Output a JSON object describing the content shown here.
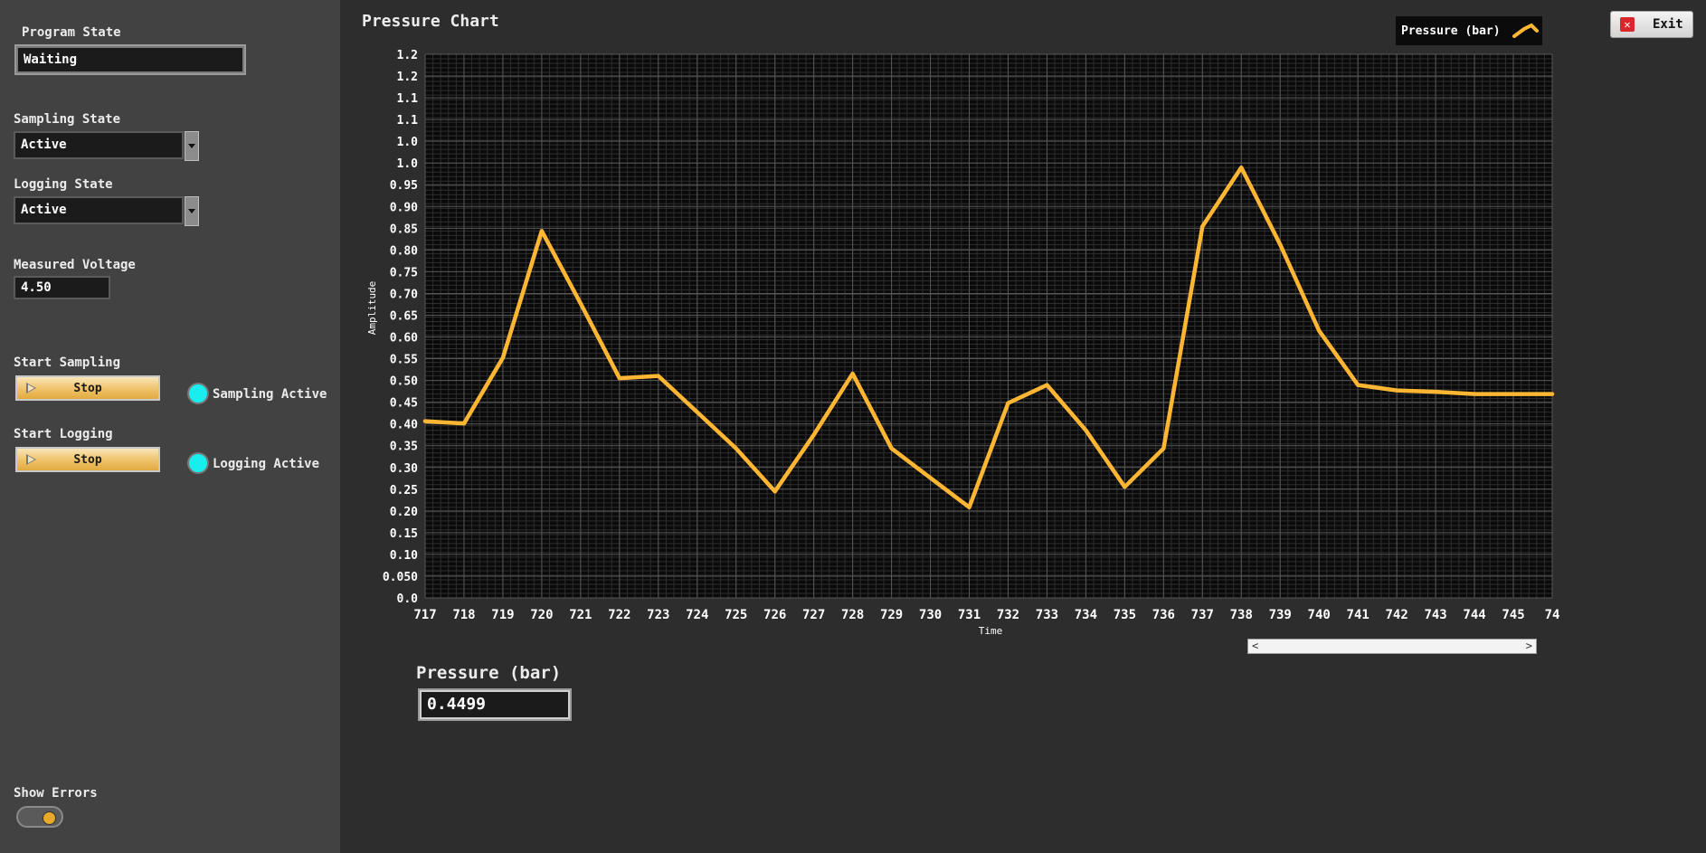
{
  "window": {
    "exit_label": "Exit"
  },
  "left": {
    "program_state": {
      "label": "Program State",
      "value": "Waiting"
    },
    "sampling_state": {
      "label": "Sampling State",
      "value": "Active"
    },
    "logging_state": {
      "label": "Logging State",
      "value": "Active"
    },
    "measured_voltage": {
      "label": "Measured Voltage",
      "value": "4.50"
    },
    "start_sampling": {
      "label": "Start Sampling",
      "button": "Stop",
      "indicator": "Sampling Active"
    },
    "start_logging": {
      "label": "Start Logging",
      "button": "Stop",
      "indicator": "Logging Active"
    },
    "show_errors": {
      "label": "Show Errors"
    }
  },
  "main": {
    "chart_title": "Pressure Chart",
    "pressure_label": "Pressure (bar)",
    "pressure_value": "0.4499"
  },
  "colors": {
    "series": "#ffb733",
    "indicator": "#19eeee",
    "plot_bg": "#0a0a0a"
  },
  "chart_data": {
    "type": "line",
    "title": "Pressure Chart",
    "xlabel": "Time",
    "ylabel": "Amplitude",
    "xlim": [
      717,
      746
    ],
    "ylim": [
      0,
      1.2
    ],
    "y_ticks": [
      "1.2",
      "1.2",
      "1.1",
      "1.1",
      "1.0",
      "1.0",
      "0.95",
      "0.90",
      "0.85",
      "0.80",
      "0.75",
      "0.70",
      "0.65",
      "0.60",
      "0.55",
      "0.50",
      "0.45",
      "0.40",
      "0.35",
      "0.30",
      "0.25",
      "0.20",
      "0.15",
      "0.10",
      "0.050",
      "0.0"
    ],
    "x_ticks": [
      "717",
      "718",
      "719",
      "720",
      "721",
      "722",
      "723",
      "724",
      "725",
      "726",
      "727",
      "728",
      "729",
      "730",
      "731",
      "732",
      "733",
      "734",
      "735",
      "736",
      "737",
      "738",
      "739",
      "740",
      "741",
      "742",
      "743",
      "744",
      "745",
      "74"
    ],
    "grid": true,
    "legend": "top-right",
    "series": [
      {
        "name": "Pressure (bar)",
        "x": [
          717,
          718,
          719,
          720,
          721,
          722,
          723,
          724,
          725,
          726,
          727,
          728,
          729,
          730,
          731,
          732,
          733,
          734,
          735,
          736,
          737,
          738,
          739,
          740,
          741,
          742,
          743,
          744,
          745,
          746
        ],
        "values": [
          0.39,
          0.385,
          0.53,
          0.81,
          0.65,
          0.485,
          0.49,
          0.41,
          0.33,
          0.235,
          0.36,
          0.495,
          0.33,
          0.265,
          0.2,
          0.43,
          0.47,
          0.37,
          0.245,
          0.33,
          0.82,
          0.95,
          0.78,
          0.59,
          0.47,
          0.458,
          0.455,
          0.45,
          0.45,
          0.45
        ]
      }
    ]
  }
}
